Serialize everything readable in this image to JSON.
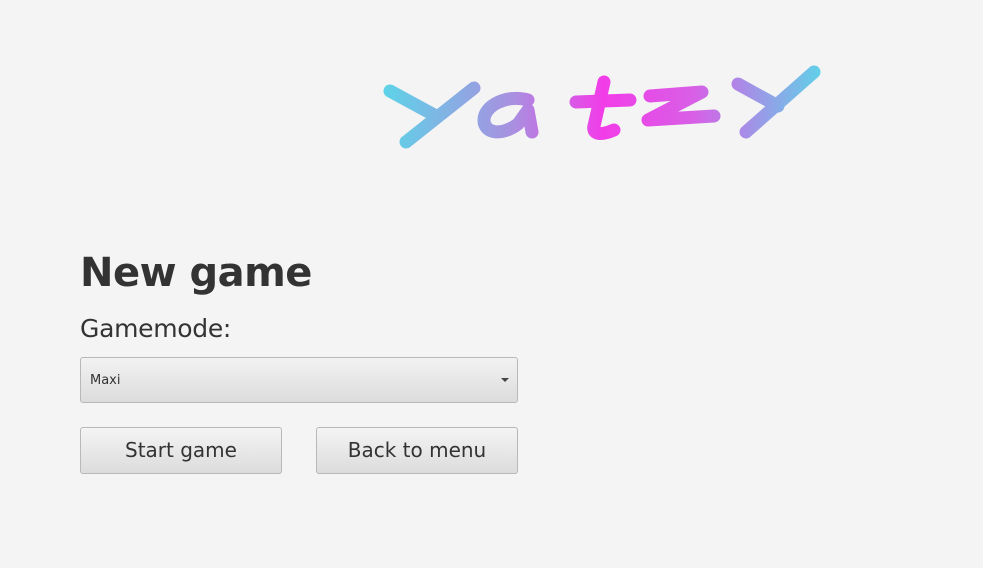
{
  "logo": {
    "text": "Yatzy",
    "colors": [
      "#5ad6e8",
      "#a98fe0",
      "#f23ce8",
      "#d85fe6",
      "#5ad6e8"
    ]
  },
  "main": {
    "title": "New game",
    "gamemode_label": "Gamemode:",
    "gamemode_select": {
      "selected": "Maxi"
    },
    "buttons": {
      "start": "Start game",
      "back": "Back to menu"
    }
  }
}
